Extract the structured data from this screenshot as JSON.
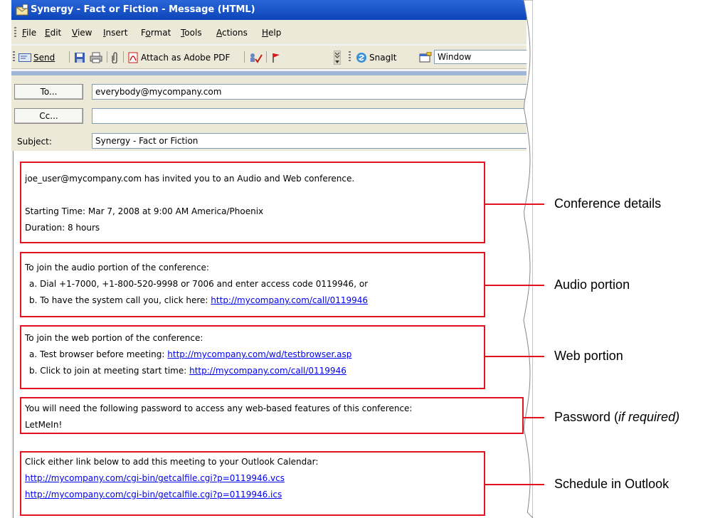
{
  "window": {
    "title": "Synergy - Fact or Fiction - Message (HTML)"
  },
  "menu": [
    {
      "label": "File",
      "u": "F"
    },
    {
      "label": "Edit",
      "u": "E"
    },
    {
      "label": "View",
      "u": "V"
    },
    {
      "label": "Insert",
      "u": "I"
    },
    {
      "label": "Format",
      "u": "o"
    },
    {
      "label": "Tools",
      "u": "T"
    },
    {
      "label": "Actions",
      "u": "A"
    },
    {
      "label": "Help",
      "u": "H"
    }
  ],
  "toolbar": {
    "send_label": "Send",
    "attach_pdf_label": "Attach as Adobe PDF",
    "snagit_label": "SnagIt",
    "window_value": "Window"
  },
  "header": {
    "to_button": "To...",
    "cc_button": "Cc...",
    "subject_label": "Subject:",
    "to_value": "everybody@mycompany.com",
    "cc_value": "",
    "subject_value": "Synergy - Fact or Fiction"
  },
  "body": {
    "conference": {
      "line1": "joe_user@mycompany.com has invited you to an Audio and Web conference.",
      "line2": "Starting Time: Mar 7, 2008 at 9:00 AM America/Phoenix",
      "line3": "Duration: 8 hours"
    },
    "audio": {
      "line1": "To join the audio portion of the conference:",
      "line2": "a. Dial +1-7000, +1-800-520-9998 or 7006 and enter access code 0119946, or",
      "line3_prefix": "b. To have the system call you, click here: ",
      "line3_link": "http://mycompany.com/call/0119946"
    },
    "web": {
      "line1": "To join the web portion of the conference:",
      "line2_prefix": "a. Test browser before meeting: ",
      "line2_link": "http://mycompany.com/wd/testbrowser.asp",
      "line3_prefix": "b. Click to join at meeting start time: ",
      "line3_link": "http://mycompany.com/call/0119946"
    },
    "password": {
      "line1": "You will need the following password to access any web-based features of this conference:",
      "line2": "LetMeIn!"
    },
    "schedule": {
      "line1": "Click either link below to add this meeting to your Outlook Calendar:",
      "link1": "http://mycompany.com/cgi-bin/getcalfile.cgi?p=0119946.vcs",
      "link2": "http://mycompany.com/cgi-bin/getcalfile.cgi?p=0119946.ics"
    }
  },
  "callouts": {
    "conference": "Conference details",
    "audio": "Audio portion",
    "web": "Web portion",
    "password_prefix": "Password (",
    "password_italic": "if required)",
    "schedule": "Schedule in Outlook"
  },
  "colors": {
    "callout": "#e0141e",
    "link": "#0000ee",
    "titlebar": "#0c44b8"
  }
}
